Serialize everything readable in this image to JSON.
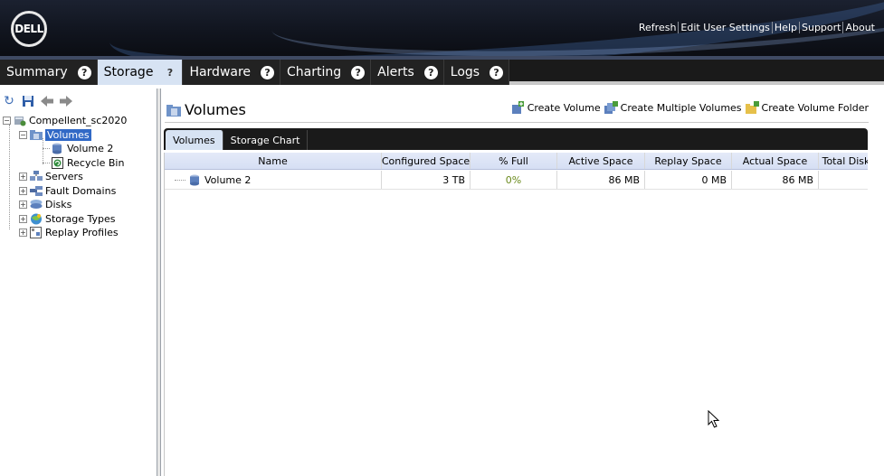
{
  "header": {
    "logo": "DELL",
    "links": [
      "Refresh",
      "Edit User Settings",
      "Help",
      "Support",
      "About"
    ]
  },
  "tabs": [
    {
      "label": "Summary",
      "help": "?",
      "active": false
    },
    {
      "label": "Storage",
      "help": "?",
      "active": true
    },
    {
      "label": "Hardware",
      "help": "?",
      "active": false
    },
    {
      "label": "Charting",
      "help": "?",
      "active": false
    },
    {
      "label": "Alerts",
      "help": "?",
      "active": false
    },
    {
      "label": "Logs",
      "help": "?",
      "active": false
    }
  ],
  "tree": {
    "root": "Compellent_sc2020",
    "volumes": "Volumes",
    "volume2": "Volume 2",
    "recycle": "Recycle Bin",
    "servers": "Servers",
    "fault_domains": "Fault Domains",
    "disks": "Disks",
    "storage_types": "Storage Types",
    "replay_profiles": "Replay Profiles"
  },
  "content": {
    "title": "Volumes",
    "actions": {
      "create_volume": "Create Volume",
      "create_multiple": "Create Multiple Volumes",
      "create_folder": "Create Volume Folder"
    },
    "subtabs": [
      "Volumes",
      "Storage Chart"
    ],
    "columns": [
      "Name",
      "Configured Space",
      "% Full",
      "Active Space",
      "Replay Space",
      "Actual Space",
      "Total Disk"
    ],
    "rows": [
      {
        "name": "Volume 2",
        "configured": "3 TB",
        "pct_full": "0%",
        "active": "86 MB",
        "replay": "0 MB",
        "actual": "86 MB",
        "total": ""
      }
    ]
  },
  "colors": {
    "accent": "#3169c6",
    "tab_active_bg": "#d7e3f3",
    "bar_dark": "#1a1a1a",
    "pct_green": "#6a8a1c"
  }
}
